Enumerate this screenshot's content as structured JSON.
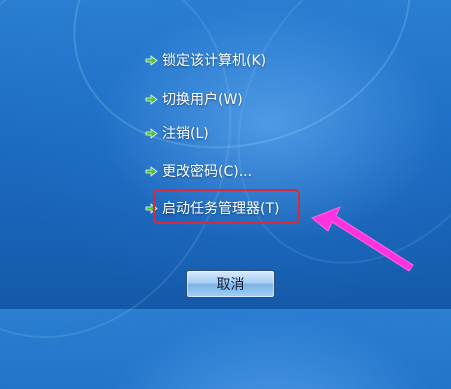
{
  "menu": {
    "items": [
      {
        "label": "锁定该计算机(K)"
      },
      {
        "label": "切换用户(W)"
      },
      {
        "label": "注销(L)"
      },
      {
        "label": "更改密码(C)..."
      },
      {
        "label": "启动任务管理器(T)"
      }
    ]
  },
  "cancel_button": {
    "label": "取消"
  },
  "colors": {
    "background": "#1c6cc3",
    "arrow_icon": "#4fbf3f",
    "highlight_border": "#d62b3e",
    "annotation_arrow": "#ff33dd"
  },
  "icons": {
    "menu_item_icon": "green-arrow-icon",
    "annotation": "pointer-arrow-icon"
  }
}
